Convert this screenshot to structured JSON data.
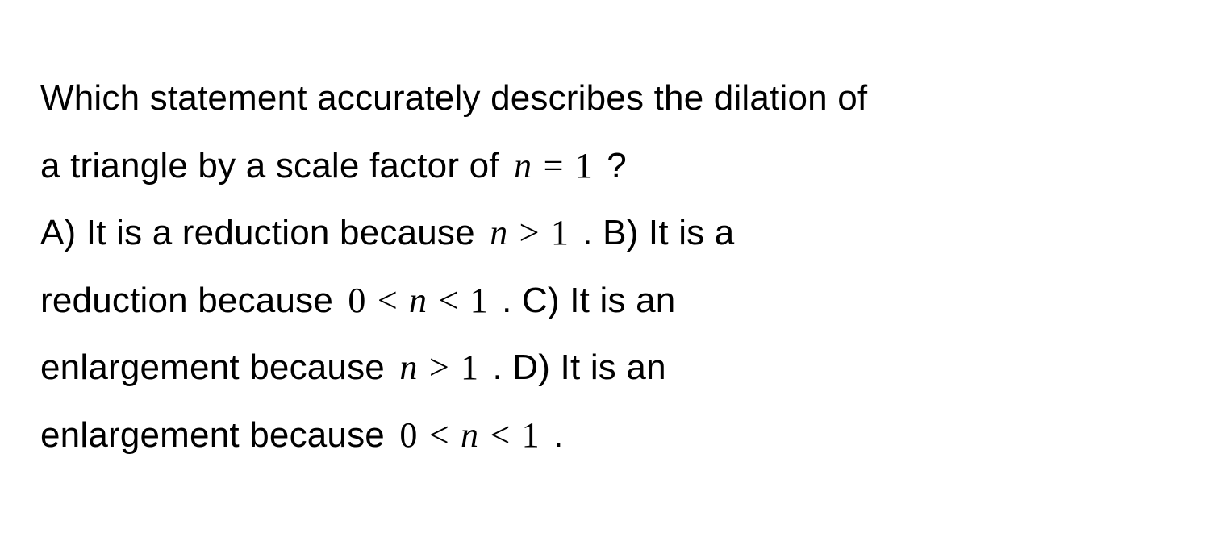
{
  "problem": {
    "question_part1": "Which statement accurately describes the dilation of",
    "question_part2": "a triangle by a scale factor of ",
    "expr_n_eq_1_var": "n",
    "expr_n_eq_1_op": "=",
    "expr_n_eq_1_val": "1",
    "question_mark": " ?",
    "opt_a_prefix": "A) It is a reduction because ",
    "expr_n_gt_1_var": "n",
    "expr_n_gt_1_op": ">",
    "expr_n_gt_1_val": "1",
    "period_sep": " . ",
    "opt_b_prefix": "B) It is a",
    "opt_b_cont": "reduction because ",
    "expr_0_lt_n_lt_1_lv": "0",
    "expr_0_lt_n_lt_1_op1": "<",
    "expr_0_lt_n_lt_1_var": "n",
    "expr_0_lt_n_lt_1_op2": "<",
    "expr_0_lt_n_lt_1_rv": "1",
    "opt_c_prefix": "C) It is an",
    "opt_c_cont": "enlargement because ",
    "opt_d_prefix": "D) It is an",
    "opt_d_cont": "enlargement because ",
    "final_period": " ."
  }
}
